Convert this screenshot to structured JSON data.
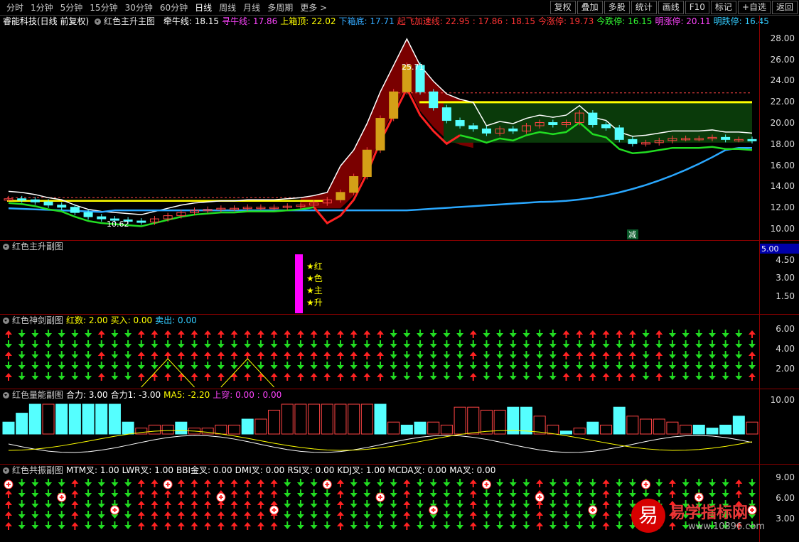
{
  "toolbar": {
    "tabs": [
      "分时",
      "1分钟",
      "5分钟",
      "15分钟",
      "30分钟",
      "60分钟",
      "日线",
      "周线",
      "月线",
      "多周期",
      "更多 >"
    ],
    "right_buttons": [
      "复权",
      "叠加",
      "多股",
      "统计",
      "画线",
      "F10",
      "标记",
      "+自选",
      "返回"
    ]
  },
  "main_panel": {
    "stock": "睿能科技(日线 前复权)",
    "indicator": "红色主升主图",
    "items": [
      {
        "label": "牵牛线: 18.15",
        "color": "#ffffff"
      },
      {
        "label": "寻牛线: 17.86",
        "color": "#ff44ff"
      },
      {
        "label": "上箱顶: 22.02",
        "color": "#ffff00"
      },
      {
        "label": "下箱底: 17.71",
        "color": "#33aaff"
      },
      {
        "label": "起飞加速线: 22.95 : 17.86 : 18.15",
        "color": "#ff3333"
      },
      {
        "label": "今涨停: 19.73",
        "color": "#ff3333"
      },
      {
        "label": "今跌停: 16.15",
        "color": "#33ff33"
      },
      {
        "label": "明涨停: 20.11",
        "color": "#ff44ff"
      },
      {
        "label": "明跌停: 16.45",
        "color": "#33ccff"
      }
    ],
    "peak_label": "25.71",
    "low_label": "10.62",
    "jian_label": "减",
    "axis": [
      "28.00",
      "26.00",
      "24.00",
      "22.00",
      "20.00",
      "18.00",
      "16.00",
      "14.00",
      "12.00",
      "10.00"
    ]
  },
  "sub1": {
    "title": "红色主升副图",
    "value_box": "5.00",
    "stars": [
      "★红",
      "★色",
      "★主",
      "★升"
    ],
    "axis": [
      "4.50",
      "3.00",
      "1.50"
    ]
  },
  "sub2": {
    "title": "红色神剑副图",
    "items": [
      {
        "label": "红数: 2.00",
        "color": "#ffff00"
      },
      {
        "label": "买入: 0.00",
        "color": "#ffff00"
      },
      {
        "label": "卖出: 0.00",
        "color": "#33ccff"
      }
    ],
    "axis": [
      "6.00",
      "4.00",
      "2.00"
    ]
  },
  "sub3": {
    "title": "红色量能副图",
    "items": [
      {
        "label": "合力: 3.00",
        "color": "#ffffff"
      },
      {
        "label": "合力1: -3.00",
        "color": "#ffffff"
      },
      {
        "label": "MA5: -2.20",
        "color": "#ffff00"
      },
      {
        "label": "上穿: 0.00 : 0.00",
        "color": "#ff44ff"
      }
    ],
    "axis": [
      "10.00"
    ]
  },
  "sub4": {
    "title": "红色共振副图",
    "items": [
      {
        "label": "MTM叉: 1.00",
        "color": "#ffffff"
      },
      {
        "label": "LWR叉: 1.00",
        "color": "#ffffff"
      },
      {
        "label": "BBI金叉: 0.00",
        "color": "#ffffff"
      },
      {
        "label": "DMI叉: 0.00",
        "color": "#ffffff"
      },
      {
        "label": "RSI叉: 0.00",
        "color": "#ffffff"
      },
      {
        "label": "KDJ叉: 1.00",
        "color": "#ffffff"
      },
      {
        "label": "MCDA叉: 0.00",
        "color": "#ffffff"
      },
      {
        "label": "MA叉: 0.00",
        "color": "#ffffff"
      }
    ],
    "axis": [
      "9.00",
      "6.00",
      "3.00"
    ]
  },
  "watermark": {
    "icon": "易",
    "text": "易学指标网",
    "url": "www.10896.com"
  }
}
